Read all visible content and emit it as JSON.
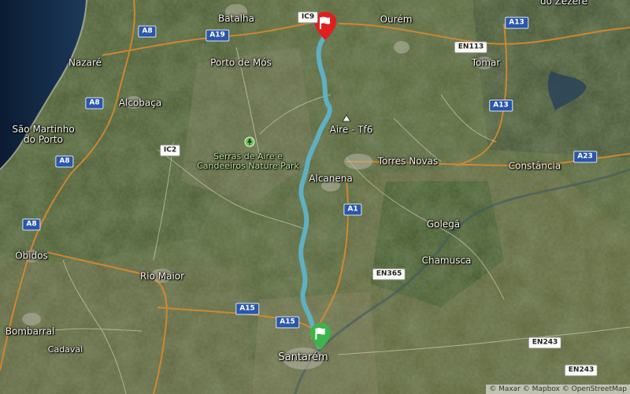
{
  "map": {
    "places": [
      {
        "id": "batalha",
        "text": "Batalha"
      },
      {
        "id": "ourem",
        "text": "Ourém"
      },
      {
        "id": "nazare",
        "text": "Nazaré"
      },
      {
        "id": "porto-de-mos",
        "text": "Porto de Mós"
      },
      {
        "id": "alcobaca",
        "text": "Alcobaça"
      },
      {
        "id": "sao-martinho",
        "text": "São Martinho\ndo Porto"
      },
      {
        "id": "serras",
        "text": "Serras de Aire e\nCandeeiros Nature Park"
      },
      {
        "id": "aire-tf6",
        "text": "Aire - Tf6"
      },
      {
        "id": "torres-novas",
        "text": "Torres Novas"
      },
      {
        "id": "constancia",
        "text": "Constância"
      },
      {
        "id": "alcanena",
        "text": "Alcanena"
      },
      {
        "id": "tomar",
        "text": "Tomar"
      },
      {
        "id": "golega",
        "text": "Golegã"
      },
      {
        "id": "chamusca",
        "text": "Chamusca"
      },
      {
        "id": "obidos",
        "text": "Óbidos"
      },
      {
        "id": "rio-maior",
        "text": "Rio Maior"
      },
      {
        "id": "bombarral",
        "text": "Bombarral"
      },
      {
        "id": "cadaval",
        "text": "Cadaval"
      },
      {
        "id": "santarem",
        "text": "Santarém"
      },
      {
        "id": "do-zezere",
        "text": "do Zêzere"
      }
    ],
    "road_shields": [
      {
        "id": "a8-1",
        "text": "A8",
        "style": "blue"
      },
      {
        "id": "a19",
        "text": "A19",
        "style": "blue"
      },
      {
        "id": "ic9",
        "text": "IC9",
        "style": "white"
      },
      {
        "id": "a13-1",
        "text": "A13",
        "style": "blue"
      },
      {
        "id": "en113",
        "text": "EN113",
        "style": "white"
      },
      {
        "id": "a8-2",
        "text": "A8",
        "style": "blue"
      },
      {
        "id": "a13-2",
        "text": "A13",
        "style": "blue"
      },
      {
        "id": "ic2",
        "text": "IC2",
        "style": "white"
      },
      {
        "id": "a8-3",
        "text": "A8",
        "style": "blue"
      },
      {
        "id": "a23",
        "text": "A23",
        "style": "blue"
      },
      {
        "id": "a1",
        "text": "A1",
        "style": "blue"
      },
      {
        "id": "a8-4",
        "text": "A8",
        "style": "blue"
      },
      {
        "id": "en365",
        "text": "EN365",
        "style": "white"
      },
      {
        "id": "a15-1",
        "text": "A15",
        "style": "blue"
      },
      {
        "id": "a15-2",
        "text": "A15",
        "style": "blue"
      },
      {
        "id": "en243-1",
        "text": "EN243",
        "style": "white"
      },
      {
        "id": "en243-2",
        "text": "EN243",
        "style": "white"
      }
    ],
    "route": {
      "color": "#5fb3c8",
      "start_flag_color": "#3cb44b",
      "end_flag_color": "#e02020"
    },
    "attribution": "© Maxar © Mapbox © OpenStreetMap"
  }
}
